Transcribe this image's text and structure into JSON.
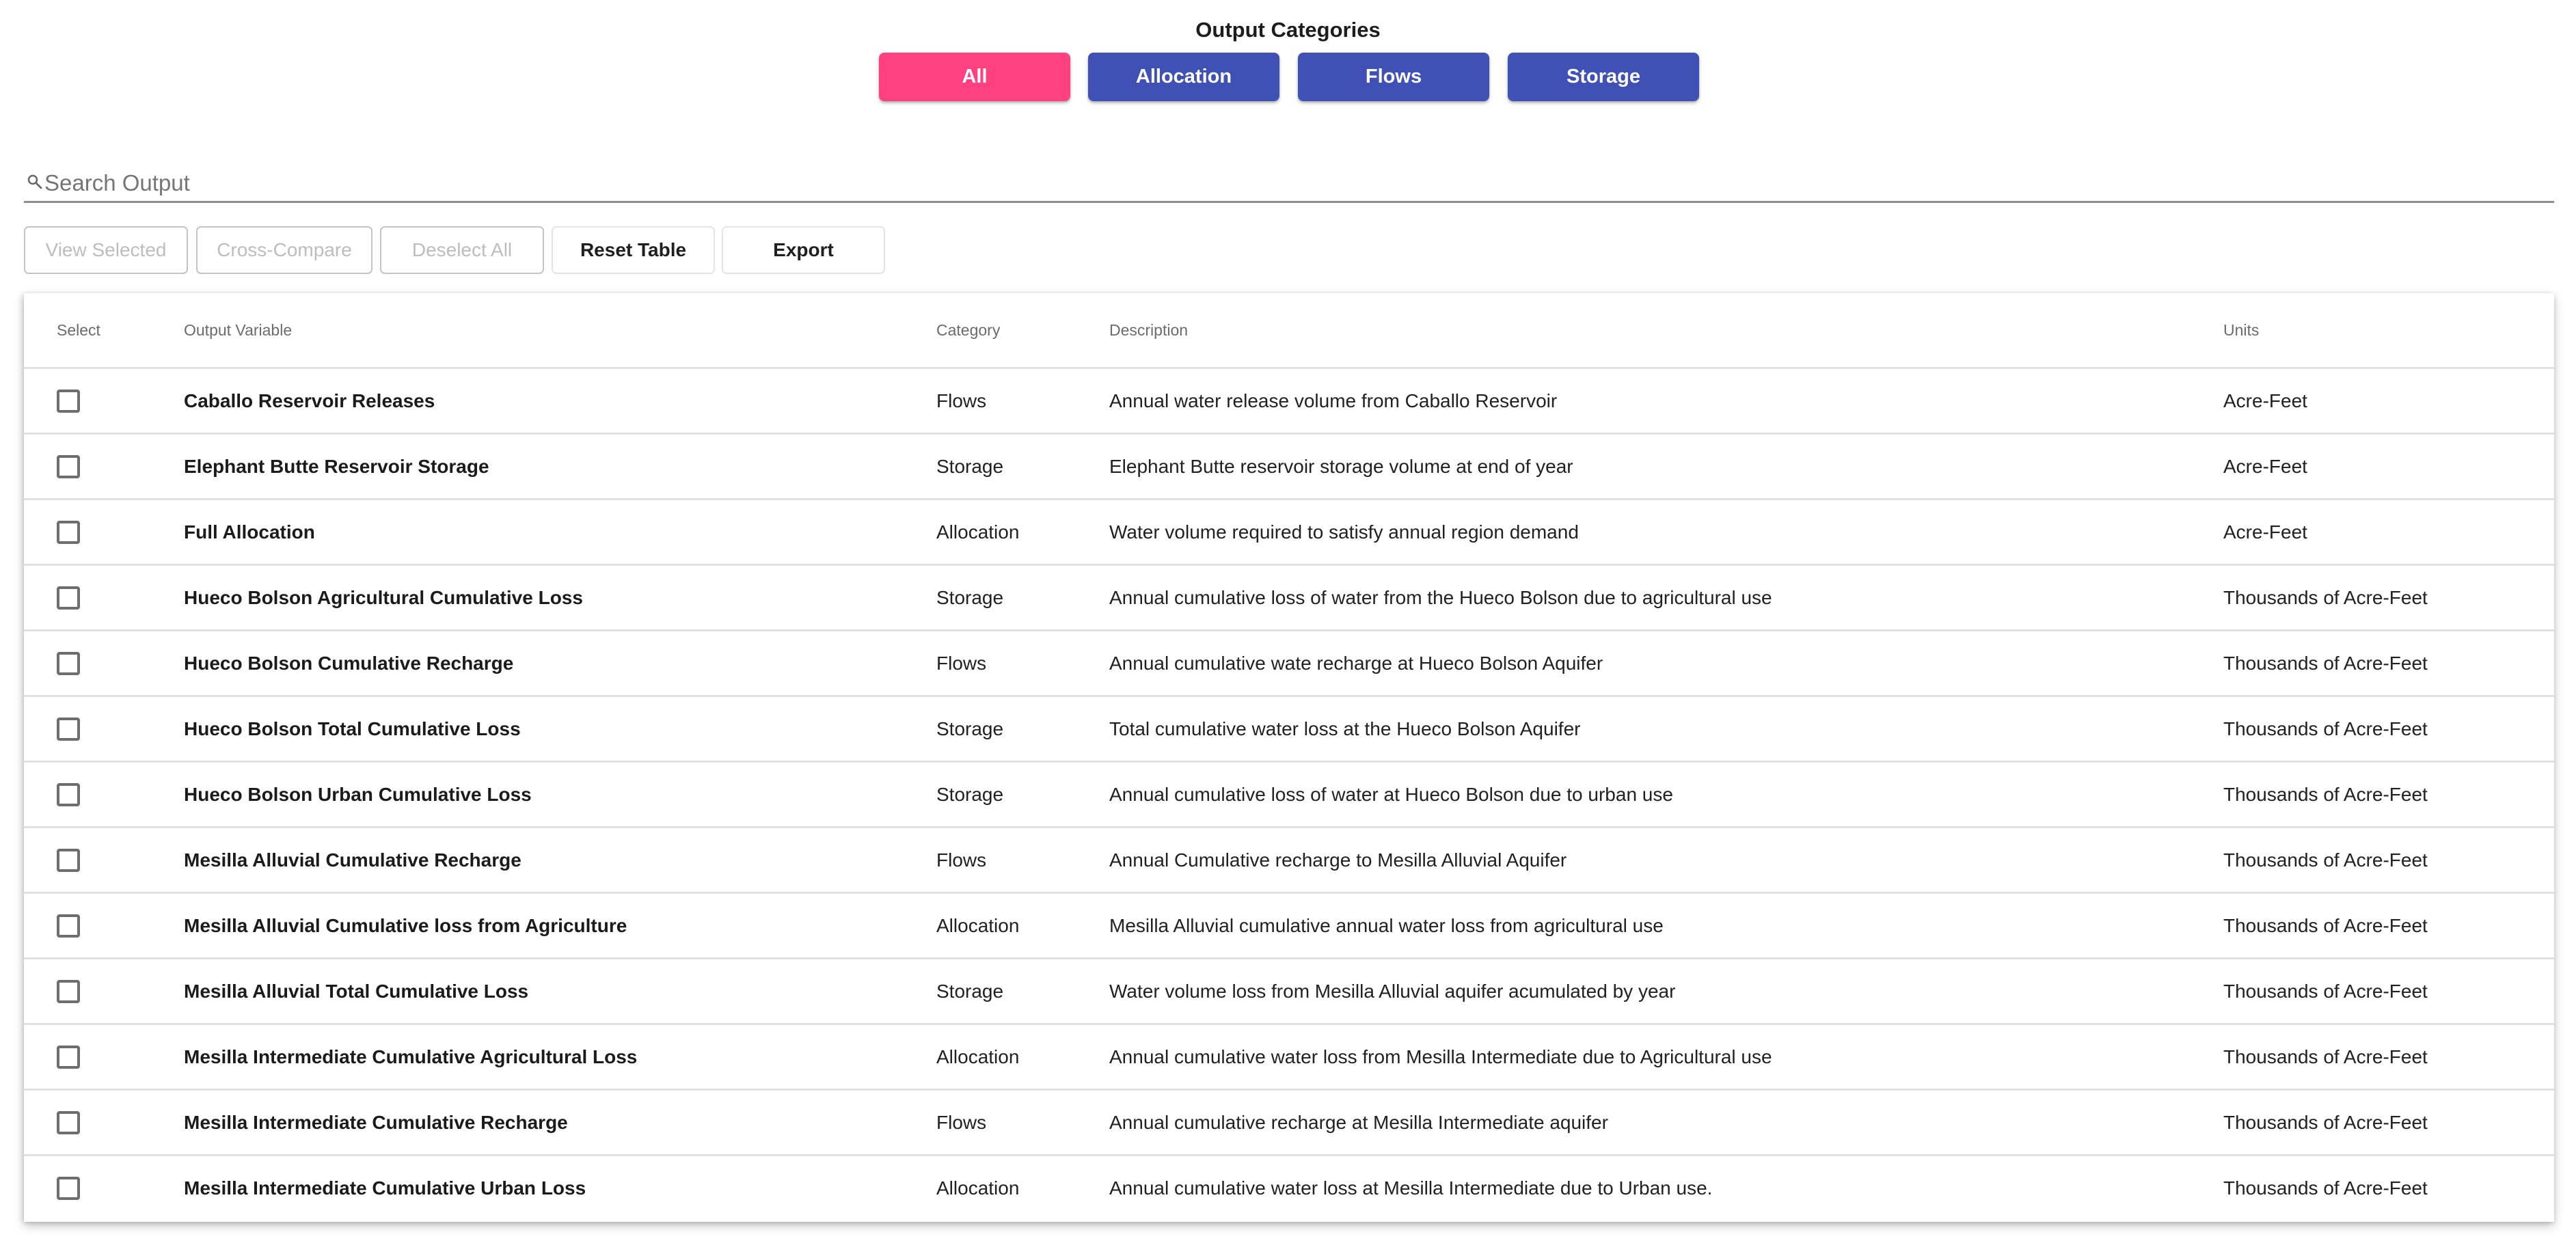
{
  "categories": {
    "title": "Output Categories",
    "buttons": [
      {
        "label": "All",
        "active": true
      },
      {
        "label": "Allocation",
        "active": false
      },
      {
        "label": "Flows",
        "active": false
      },
      {
        "label": "Storage",
        "active": false
      }
    ],
    "colors": {
      "active": "#FF4081",
      "inactive": "#3F51B5"
    }
  },
  "search": {
    "icon": "search-icon",
    "placeholder": "Search Output",
    "value": ""
  },
  "toolbar": {
    "view_selected": "View Selected",
    "cross_compare": "Cross-Compare",
    "deselect_all": "Deselect All",
    "reset_table": "Reset Table",
    "export": "Export"
  },
  "table": {
    "headers": {
      "select": "Select",
      "variable": "Output Variable",
      "category": "Category",
      "description": "Description",
      "units": "Units"
    },
    "rows": [
      {
        "checked": false,
        "variable": "Caballo Reservoir Releases",
        "category": "Flows",
        "description": "Annual water release volume from Caballo Reservoir",
        "units": "Acre-Feet"
      },
      {
        "checked": false,
        "variable": "Elephant Butte Reservoir Storage",
        "category": "Storage",
        "description": "Elephant Butte reservoir storage volume at end of year",
        "units": "Acre-Feet"
      },
      {
        "checked": false,
        "variable": "Full Allocation",
        "category": "Allocation",
        "description": "Water volume required to satisfy annual region demand",
        "units": "Acre-Feet"
      },
      {
        "checked": false,
        "variable": "Hueco Bolson Agricultural Cumulative Loss",
        "category": "Storage",
        "description": "Annual cumulative loss of water from the Hueco Bolson due to agricultural use",
        "units": "Thousands of Acre-Feet"
      },
      {
        "checked": false,
        "variable": "Hueco Bolson Cumulative Recharge",
        "category": "Flows",
        "description": "Annual cumulative wate recharge at Hueco Bolson Aquifer",
        "units": "Thousands of Acre-Feet"
      },
      {
        "checked": false,
        "variable": "Hueco Bolson Total Cumulative Loss",
        "category": "Storage",
        "description": "Total cumulative water loss at the Hueco Bolson Aquifer",
        "units": "Thousands of Acre-Feet"
      },
      {
        "checked": false,
        "variable": "Hueco Bolson Urban Cumulative Loss",
        "category": "Storage",
        "description": "Annual cumulative loss of water at Hueco Bolson due to urban use",
        "units": "Thousands of Acre-Feet"
      },
      {
        "checked": false,
        "variable": "Mesilla Alluvial Cumulative Recharge",
        "category": "Flows",
        "description": "Annual Cumulative recharge to Mesilla Alluvial Aquifer",
        "units": "Thousands of Acre-Feet"
      },
      {
        "checked": false,
        "variable": "Mesilla Alluvial Cumulative loss from Agriculture",
        "category": "Allocation",
        "description": "Mesilla Alluvial cumulative annual water loss from agricultural use",
        "units": "Thousands of Acre-Feet"
      },
      {
        "checked": false,
        "variable": "Mesilla Alluvial Total Cumulative Loss",
        "category": "Storage",
        "description": "Water volume loss from Mesilla Alluvial aquifer acumulated by year",
        "units": "Thousands of Acre-Feet"
      },
      {
        "checked": false,
        "variable": "Mesilla Intermediate Cumulative Agricultural Loss",
        "category": "Allocation",
        "description": "Annual cumulative water loss from Mesilla Intermediate due to Agricultural use",
        "units": "Thousands of Acre-Feet"
      },
      {
        "checked": false,
        "variable": "Mesilla Intermediate Cumulative Recharge",
        "category": "Flows",
        "description": "Annual cumulative recharge at Mesilla Intermediate aquifer",
        "units": "Thousands of Acre-Feet"
      },
      {
        "checked": false,
        "variable": "Mesilla Intermediate Cumulative Urban Loss",
        "category": "Allocation",
        "description": "Annual cumulative water loss at Mesilla Intermediate due to Urban use.",
        "units": "Thousands of Acre-Feet"
      }
    ]
  }
}
